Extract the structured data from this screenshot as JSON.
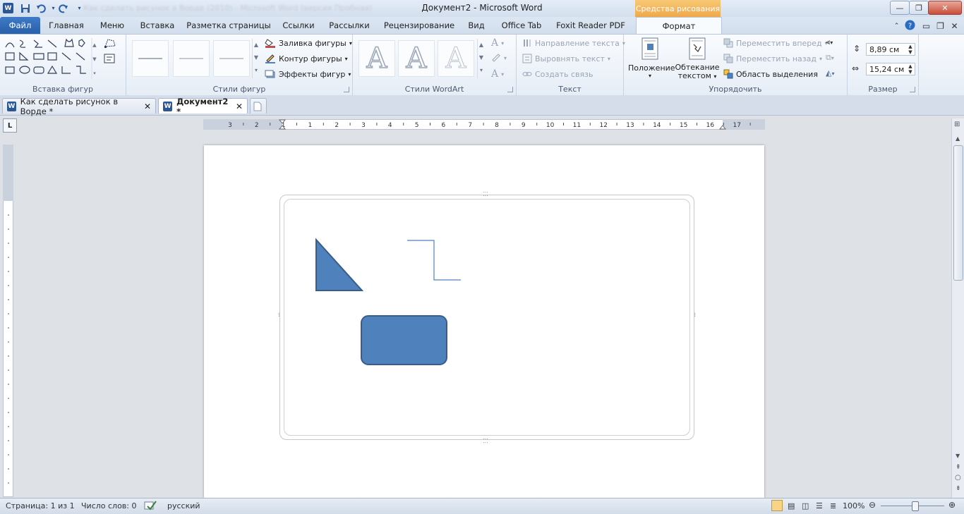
{
  "window": {
    "title": "Документ2 - Microsoft Word",
    "contextual_group": "Средства рисования",
    "blurred_title": "Как сделать рисунок в Ворде (2010) - Microsoft Word (версия Пробная)"
  },
  "tabs": [
    {
      "label": "Файл"
    },
    {
      "label": "Главная"
    },
    {
      "label": "Меню"
    },
    {
      "label": "Вставка"
    },
    {
      "label": "Разметка страницы"
    },
    {
      "label": "Ссылки"
    },
    {
      "label": "Рассылки"
    },
    {
      "label": "Рецензирование"
    },
    {
      "label": "Вид"
    },
    {
      "label": "Office Tab"
    },
    {
      "label": "Foxit Reader PDF"
    },
    {
      "label": "Формат"
    }
  ],
  "ribbon": {
    "insert_shapes": {
      "label": "Вставка фигур"
    },
    "shape_styles": {
      "label": "Стили фигур",
      "fill": "Заливка фигуры",
      "outline": "Контур фигуры",
      "effects": "Эффекты фигур"
    },
    "wordart": {
      "label": "Стили WordArt",
      "letter": "A"
    },
    "text": {
      "label": "Текст",
      "direction": "Направление текста",
      "align": "Выровнять текст",
      "link": "Создать связь"
    },
    "arrange": {
      "label": "Упорядочить",
      "position": "Положение",
      "wrap_line1": "Обтекание",
      "wrap_line2": "текстом",
      "bring_forward": "Переместить вперед",
      "send_backward": "Переместить назад",
      "selection_pane": "Область выделения"
    },
    "size": {
      "label": "Размер",
      "height": "8,89 см",
      "width": "15,24 см"
    }
  },
  "doc_tabs": [
    {
      "label": "Как сделать рисунок в Ворде *"
    },
    {
      "label": "Документ2 *"
    }
  ],
  "ruler": {
    "labels": [
      "3",
      "2",
      "1",
      "1",
      "2",
      "3",
      "4",
      "5",
      "6",
      "7",
      "8",
      "9",
      "10",
      "11",
      "12",
      "13",
      "14",
      "15",
      "16",
      "17"
    ]
  },
  "tab_selector": "L",
  "status": {
    "page": "Страница: 1 из 1",
    "words": "Число слов: 0",
    "language": "русский",
    "zoom": "100%",
    "zoom_percent": 100
  },
  "colors": {
    "shape_fill": "#4f81bd",
    "shape_stroke": "#385d8a",
    "accent_blue": "#2a5ea8",
    "contextual_orange": "#f0a84a"
  }
}
